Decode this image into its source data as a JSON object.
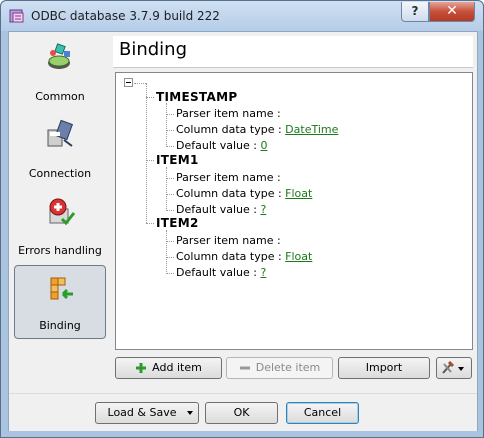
{
  "window": {
    "title": "ODBC database 3.7.9 build 222",
    "help_label": "?",
    "close_label": "✕"
  },
  "sidebar": {
    "items": [
      {
        "label": "Common",
        "icon": "common-icon"
      },
      {
        "label": "Connection",
        "icon": "connection-icon"
      },
      {
        "label": "Errors handling",
        "icon": "errors-icon"
      },
      {
        "label": "Binding",
        "icon": "binding-icon",
        "active": true
      }
    ]
  },
  "header": {
    "title": "Binding"
  },
  "tree": {
    "nodes": [
      {
        "name": "TIMESTAMP",
        "parser_label": "Parser item name :",
        "type_label": "Column data type :",
        "type_value": "DateTime",
        "default_label": "Default value :",
        "default_value": "0"
      },
      {
        "name": "ITEM1",
        "parser_label": "Parser item name :",
        "type_label": "Column data type :",
        "type_value": "Float",
        "default_label": "Default value :",
        "default_value": "?"
      },
      {
        "name": "ITEM2",
        "parser_label": "Parser item name :",
        "type_label": "Column data type :",
        "type_value": "Float",
        "default_label": "Default value :",
        "default_value": "?"
      }
    ]
  },
  "actions": {
    "add_label": "Add item",
    "delete_label": "Delete item",
    "import_label": "Import"
  },
  "footer": {
    "load_save_label": "Load & Save",
    "ok_label": "OK",
    "cancel_label": "Cancel"
  },
  "colors": {
    "accent": "#1a7a1a",
    "title_bar": "#cfe0f3",
    "close": "#c7503a"
  }
}
